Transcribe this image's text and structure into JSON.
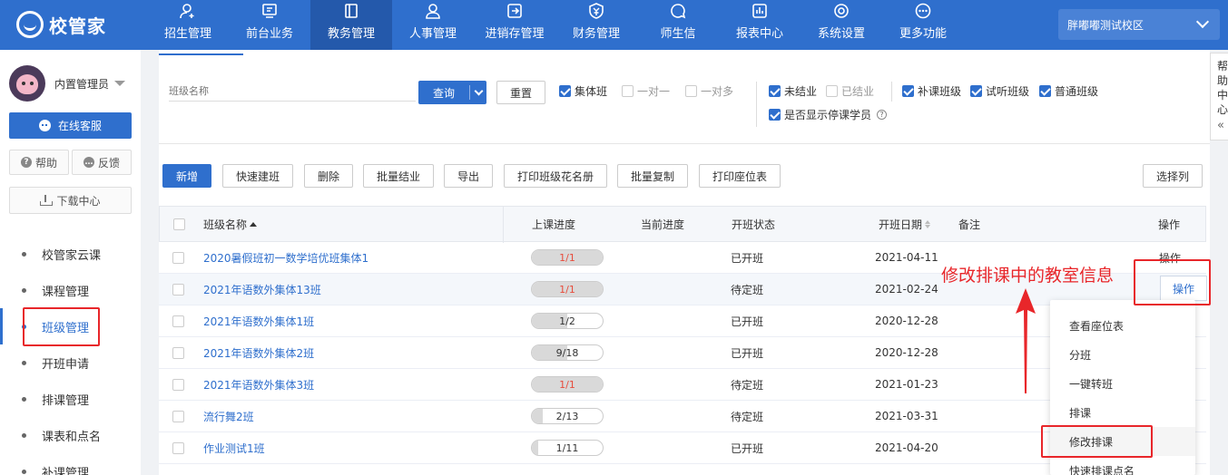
{
  "app": {
    "logo_text": "校管家"
  },
  "nav": [
    {
      "label": "招生管理",
      "icon": "user-plus-icon"
    },
    {
      "label": "前台业务",
      "icon": "monitor-icon"
    },
    {
      "label": "教务管理",
      "icon": "book-icon",
      "active": true
    },
    {
      "label": "人事管理",
      "icon": "person-icon"
    },
    {
      "label": "进销存管理",
      "icon": "login-box-icon"
    },
    {
      "label": "财务管理",
      "icon": "yen-shield-icon"
    },
    {
      "label": "师生信",
      "icon": "chat-bubble-icon"
    },
    {
      "label": "报表中心",
      "icon": "bar-chart-icon"
    },
    {
      "label": "系统设置",
      "icon": "gear-icon"
    },
    {
      "label": "更多功能",
      "icon": "more-dots-icon"
    }
  ],
  "campus": {
    "name": "胖嘟嘟测试校区"
  },
  "sidebar": {
    "user_name": "内置管理员",
    "service_label": "在线客服",
    "help_label": "帮助",
    "feedback_label": "反馈",
    "download_label": "下载中心",
    "items": [
      "校管家云课",
      "课程管理",
      "班级管理",
      "开班申请",
      "排课管理",
      "课表和点名",
      "补课管理"
    ],
    "active_index": 2
  },
  "filters": {
    "class_name_placeholder": "班级名称",
    "query_label": "查询",
    "reset_label": "重置",
    "type_checks": [
      {
        "label": "集体班",
        "checked": true
      },
      {
        "label": "一对一",
        "checked": false
      },
      {
        "label": "一对多",
        "checked": false
      }
    ],
    "status_checks": [
      {
        "label": "未结业",
        "checked": true
      },
      {
        "label": "已结业",
        "checked": false
      }
    ],
    "show_paused": {
      "label": "是否显示停课学员",
      "checked": true
    },
    "kind_checks": [
      {
        "label": "补课班级",
        "checked": true
      },
      {
        "label": "试听班级",
        "checked": true
      },
      {
        "label": "普通班级",
        "checked": true
      }
    ]
  },
  "toolbar": {
    "add": "新增",
    "quick_create": "快速建班",
    "delete": "删除",
    "batch_graduate": "批量结业",
    "export": "导出",
    "print_roster": "打印班级花名册",
    "batch_copy": "批量复制",
    "print_seating": "打印座位表",
    "select_columns": "选择列"
  },
  "table": {
    "headers": {
      "name": "班级名称",
      "progress": "上课进度",
      "current": "当前进度",
      "status": "开班状态",
      "date": "开班日期",
      "note": "备注",
      "action": "操作"
    },
    "rows": [
      {
        "name": "2020暑假班初一数学培优班集体1",
        "progress": "1/1",
        "done": 1,
        "total": 1,
        "status": "已开班",
        "date": "2021-04-11",
        "action": "操作"
      },
      {
        "name": "2021年语数外集体13班",
        "progress": "1/1",
        "done": 1,
        "total": 1,
        "status": "待定班",
        "date": "2021-02-24",
        "action": "操作"
      },
      {
        "name": "2021年语数外集体1班",
        "progress": "1/2",
        "done": 1,
        "total": 2,
        "status": "已开班",
        "date": "2020-12-28"
      },
      {
        "name": "2021年语数外集体2班",
        "progress": "9/18",
        "done": 9,
        "total": 18,
        "status": "已开班",
        "date": "2020-12-28"
      },
      {
        "name": "2021年语数外集体3班",
        "progress": "1/1",
        "done": 1,
        "total": 1,
        "status": "待定班",
        "date": "2021-01-23"
      },
      {
        "name": "流行舞2班",
        "progress": "2/13",
        "done": 2,
        "total": 13,
        "status": "待定班",
        "date": "2021-03-31"
      },
      {
        "name": "作业测试1班",
        "progress": "1/11",
        "done": 1,
        "total": 11,
        "status": "已开班",
        "date": "2021-04-20"
      }
    ]
  },
  "dropdown": {
    "items": [
      "查看座位表",
      "分班",
      "一键转班",
      "排课",
      "修改排课",
      "快速排课点名"
    ],
    "hover_index": 4
  },
  "annotation": {
    "text": "修改排课中的教室信息"
  },
  "help_tab": {
    "chars": [
      "帮",
      "助",
      "中",
      "心"
    ],
    "arrow": "«"
  },
  "colors": {
    "primary": "#2f6fcd",
    "annotation_red": "#e8262a",
    "progress_done": "#e74c3c"
  }
}
